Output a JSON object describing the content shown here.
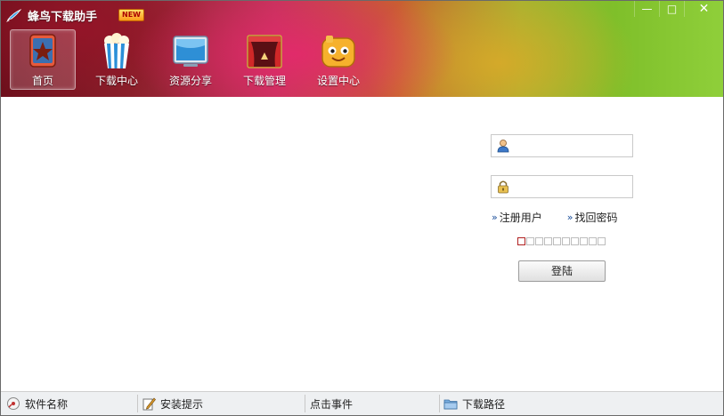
{
  "app": {
    "title": "蜂鸟下载助手",
    "badge": "NEW"
  },
  "window_controls": {
    "minimize": "—",
    "maximize": "□",
    "close": "✕"
  },
  "nav": [
    {
      "label": "首页",
      "icon": "home-book-icon",
      "active": true
    },
    {
      "label": "下载中心",
      "icon": "popcorn-icon",
      "active": false
    },
    {
      "label": "资源分享",
      "icon": "monitor-icon",
      "active": false
    },
    {
      "label": "下载管理",
      "icon": "stage-curtain-icon",
      "active": false
    },
    {
      "label": "设置中心",
      "icon": "smiley-face-icon",
      "active": false
    }
  ],
  "login": {
    "username_value": "",
    "password_value": "",
    "register_link": "注册用户",
    "recover_link": "找回密码",
    "login_button": "登陆"
  },
  "status_bar": {
    "software_name": "软件名称",
    "install_tip": "安装提示",
    "click_event": "点击事件",
    "download_path": "下载路径"
  },
  "colors": {
    "link_arrow": "#1a4e9a",
    "strength_first": "#b02020"
  }
}
